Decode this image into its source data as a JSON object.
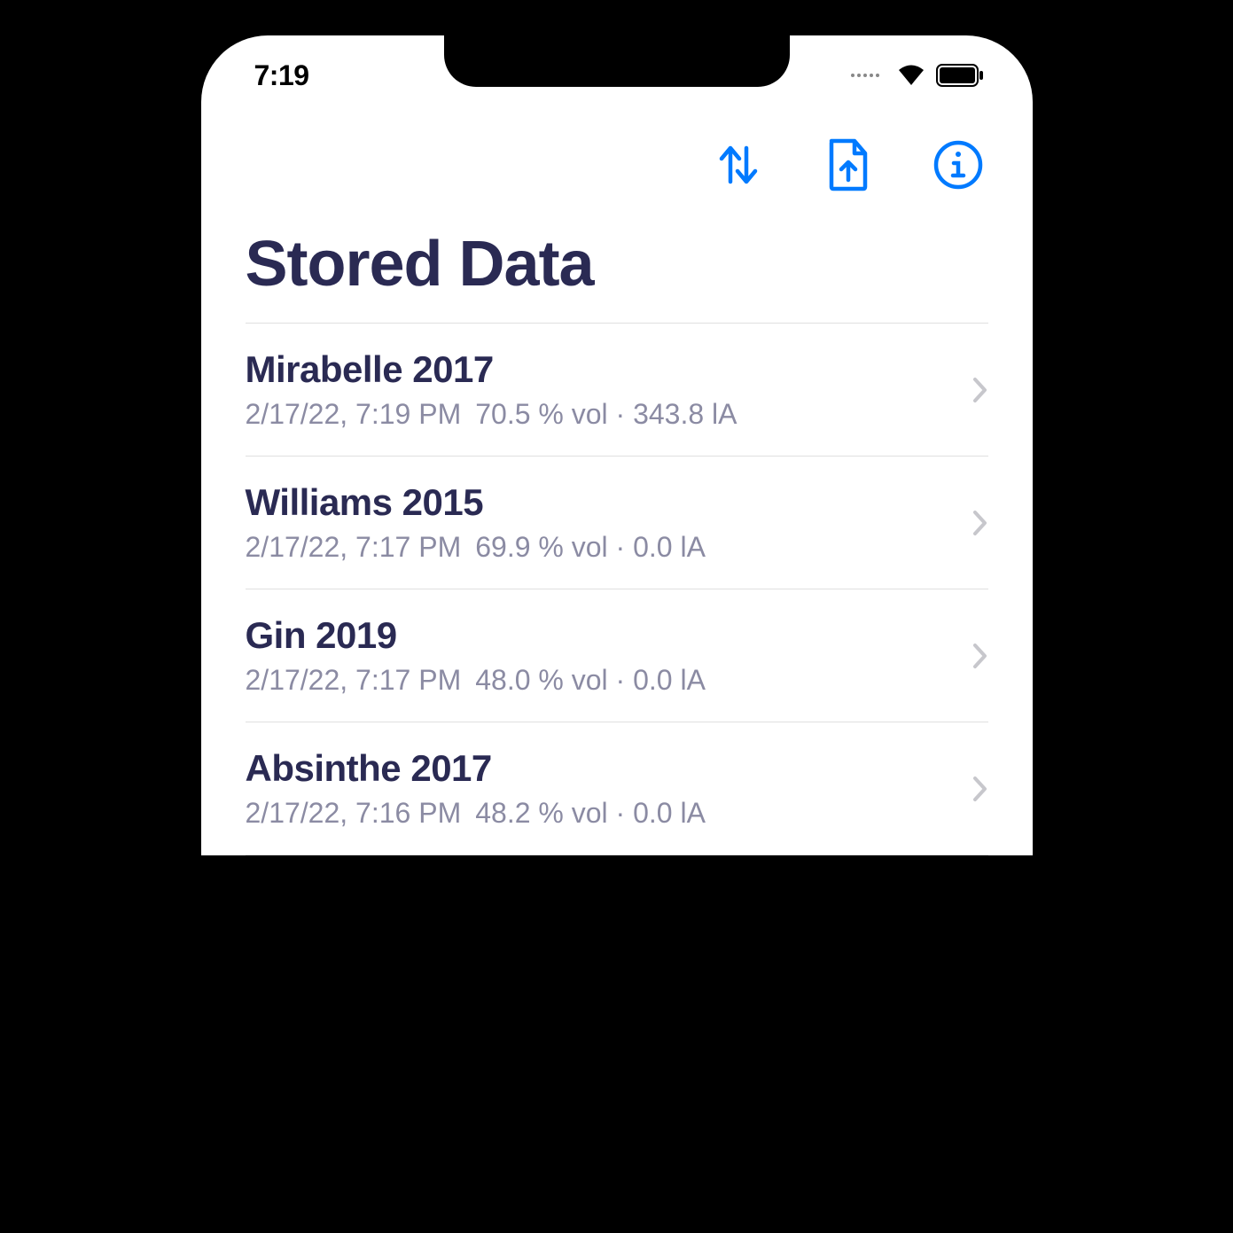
{
  "status": {
    "time": "7:19"
  },
  "page": {
    "title": "Stored Data"
  },
  "colors": {
    "accent": "#007aff",
    "text_primary": "#2a2a53",
    "text_secondary": "#8b8ba3"
  },
  "items": [
    {
      "name": "Mirabelle 2017",
      "timestamp": "2/17/22, 7:19 PM",
      "metrics": "70.5 % vol · 343.8 lA"
    },
    {
      "name": "Williams 2015",
      "timestamp": "2/17/22, 7:17 PM",
      "metrics": "69.9 % vol · 0.0 lA"
    },
    {
      "name": "Gin 2019",
      "timestamp": "2/17/22, 7:17 PM",
      "metrics": "48.0 % vol · 0.0 lA"
    },
    {
      "name": "Absinthe 2017",
      "timestamp": "2/17/22, 7:16 PM",
      "metrics": "48.2 % vol · 0.0 lA"
    }
  ]
}
